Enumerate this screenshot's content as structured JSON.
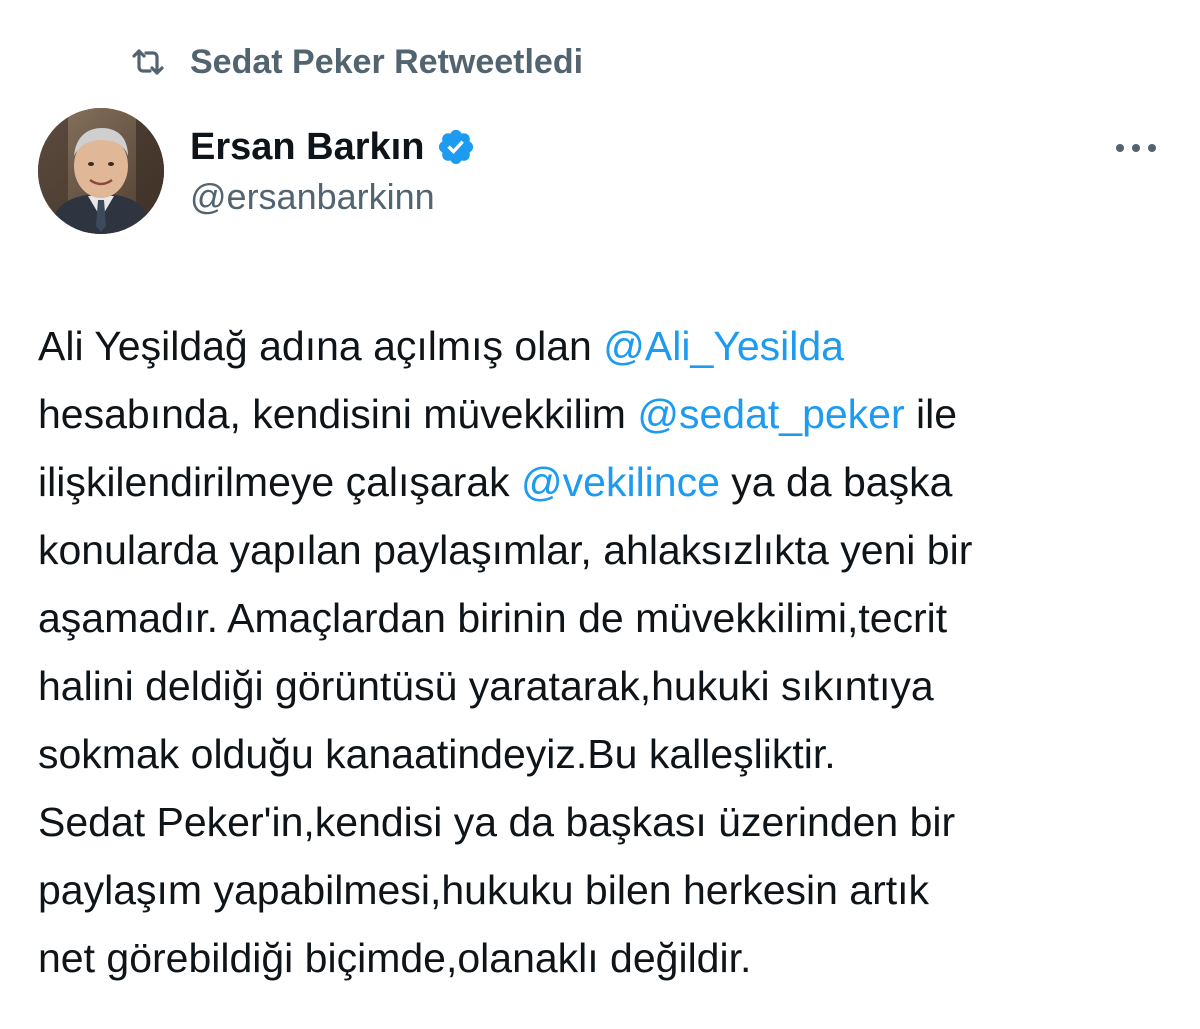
{
  "retweet": {
    "icon": "retweet-icon",
    "label": "Sedat Peker Retweetledi"
  },
  "author": {
    "display_name": "Ersan Barkın",
    "handle": "@ersanbarkinn",
    "verified_icon": "verified-badge-icon",
    "avatar_icon": "avatar"
  },
  "more_menu": {
    "icon": "more-options-icon"
  },
  "colors": {
    "text": "#0f1419",
    "secondary": "#536471",
    "mention": "#1d9bf0",
    "verified": "#1d9bf0"
  },
  "tweet": {
    "lines": [
      [
        {
          "text": "Ali Yeşildağ adına açılmış olan "
        },
        {
          "text": "@Ali_Yesilda",
          "mention": true
        }
      ],
      [
        {
          "text": "hesabında, kendisini müvekkilim "
        },
        {
          "text": "@sedat_peker",
          "mention": true
        },
        {
          "text": " ile"
        }
      ],
      [
        {
          "text": "ilişkilendirilmeye çalışarak "
        },
        {
          "text": "@vekilince",
          "mention": true
        },
        {
          "text": " ya da başka"
        }
      ],
      [
        {
          "text": "konularda yapılan paylaşımlar, ahlaksızlıkta yeni bir"
        }
      ],
      [
        {
          "text": "aşamadır. Amaçlardan birinin de müvekkilimi,tecrit"
        }
      ],
      [
        {
          "text": "halini deldiği görüntüsü yaratarak,hukuki sıkıntıya"
        }
      ],
      [
        {
          "text": "sokmak olduğu kanaatindeyiz.Bu kalleşliktir."
        }
      ],
      [
        {
          "text": "Sedat Peker'in,kendisi ya da başkası üzerinden bir"
        }
      ],
      [
        {
          "text": "paylaşım yapabilmesi,hukuku bilen herkesin artık"
        }
      ],
      [
        {
          "text": "net görebildiği biçimde,olanaklı değildir."
        }
      ]
    ]
  }
}
